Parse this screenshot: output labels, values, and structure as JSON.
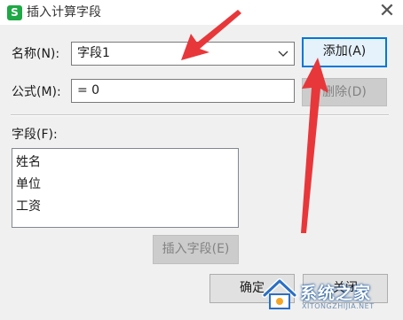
{
  "window": {
    "app_icon_letter": "S",
    "title": "插入计算字段",
    "close_glyph": "✕"
  },
  "form": {
    "name_label": "名称(N):",
    "name_value": "字段1",
    "formula_label": "公式(M):",
    "formula_value": "= 0",
    "add_button": "添加(A)",
    "delete_button": "删除(D)",
    "fields_label": "字段(F):",
    "fields": [
      "姓名",
      "单位",
      "工资"
    ],
    "insert_field_button": "插入字段(E)",
    "ok_button": "确定",
    "close_button": "关闭"
  },
  "annotations": {
    "arrow_color": "#e8373a",
    "arrow_count": 2
  },
  "watermark": {
    "text": "系统之家",
    "url": "XITONGZHIJIA.NET"
  },
  "colors": {
    "dialog_bg": "#f0f0f0",
    "app_icon": "#1fa845",
    "focus_border": "#0078d7"
  }
}
